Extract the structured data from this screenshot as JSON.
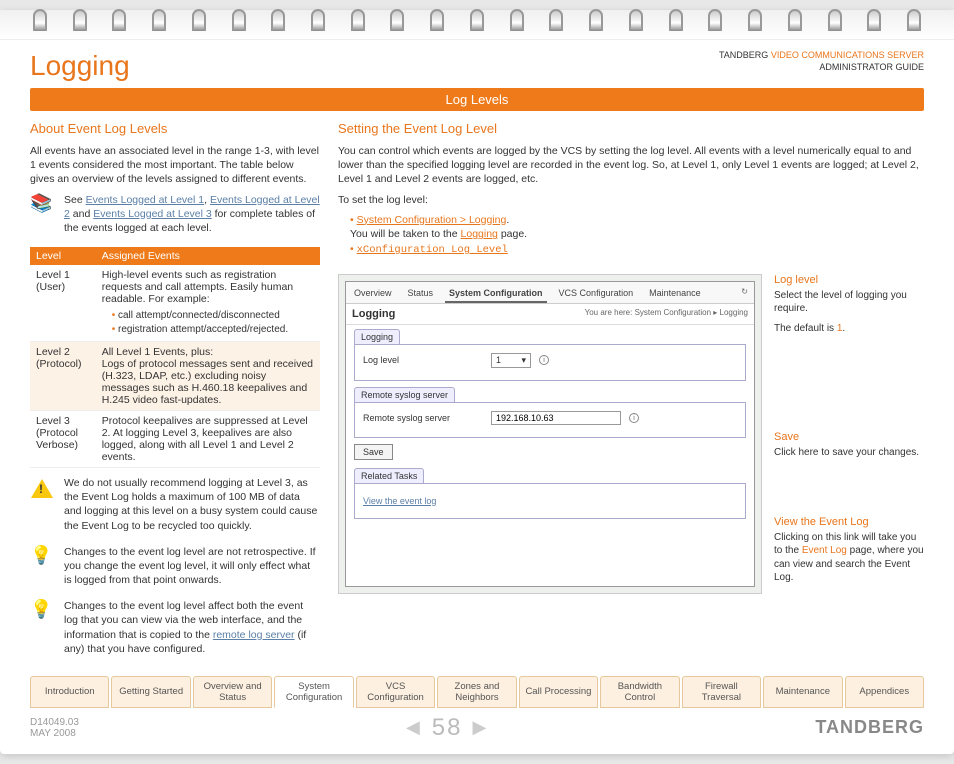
{
  "header": {
    "title": "Logging",
    "company": "TANDBERG",
    "product": "VIDEO COMMUNICATIONS SERVER",
    "guide": "ADMINISTRATOR GUIDE"
  },
  "bar": "Log Levels",
  "about": {
    "title": "About Event Log Levels",
    "intro": "All events have an associated level in the range 1-3, with level 1 events considered the most important. The table below gives an overview of the levels assigned to different events.",
    "see_pre": "See ",
    "link1": "Events Logged at Level 1",
    "link2": "Events Logged at Level 2",
    "and": " and ",
    "link3": "Events Logged at Level 3",
    "see_post": " for complete tables of the events logged at each level.",
    "th_level": "Level",
    "th_events": "Assigned Events",
    "rows": [
      {
        "level": "Level 1 (User)",
        "desc": "High-level events such as registration requests and call attempts. Easily human readable. For example:",
        "sub": [
          "call attempt/connected/disconnected",
          "registration attempt/accepted/rejected."
        ]
      },
      {
        "level": "Level 2 (Protocol)",
        "desc_pre": "All Level 1 Events, plus:",
        "desc": "Logs of protocol messages sent and received (H.323, LDAP, etc.) excluding noisy messages such as H.460.18 keepalives and H.245 video fast-updates."
      },
      {
        "level": "Level 3 (Protocol Verbose)",
        "desc": "Protocol keepalives are suppressed at Level 2. At logging Level 3, keepalives are also logged, along with all Level 1 and Level 2 events."
      }
    ],
    "warn": "We do not usually recommend logging at Level 3, as the Event Log holds a maximum of 100 MB of data and logging at this level on a busy system could cause the Event Log to be recycled too quickly.",
    "tip1": "Changes to the event log level are not retrospective.  If you change the event log level, it will only effect what is logged from that point onwards.",
    "tip2_pre": "Changes to the event log level affect both the event log that you can view via the web interface, and the information that is copied to the ",
    "tip2_link": "remote log server",
    "tip2_post": " (if any) that you have configured."
  },
  "setting": {
    "title": "Setting the Event Log Level",
    "intro": "You can control which events are logged by the VCS by setting the log level. All events with a level numerically equal to and lower than the specified logging level are recorded in the event log. So, at Level 1, only Level 1 events are logged; at Level 2, Level 1 and Level 2 events are logged, etc.",
    "toset": "To set the log level:",
    "nav": "System Configuration > Logging",
    "navpost": ".",
    "taken_pre": "You will be taken to the ",
    "taken_link": "Logging",
    "taken_post": " page.",
    "cmd": "xConfiguration Log Level"
  },
  "screenshot": {
    "tabs": [
      "Overview",
      "Status",
      "System Configuration",
      "VCS Configuration",
      "Maintenance"
    ],
    "active_tab": 2,
    "refresh": "↻",
    "heading": "Logging",
    "breadcrumb": "You are here: System Configuration ▸ Logging",
    "subtab": "Logging",
    "row1_label": "Log level",
    "row1_value": "1",
    "group2_label": "Remote syslog server",
    "row2_label": "Remote syslog server",
    "row2_value": "192.168.10.63",
    "save": "Save",
    "related": "Related Tasks",
    "viewlog": "View the event log"
  },
  "callouts": {
    "loglevel": {
      "title": "Log level",
      "body": "Select the level of logging you require.",
      "default_pre": "The default is ",
      "default_val": "1",
      "default_post": "."
    },
    "save": {
      "title": "Save",
      "body": "Click here to save your changes."
    },
    "view": {
      "title": "View the Event Log",
      "body_pre": "Clicking on this link will take you to the ",
      "body_link": "Event Log",
      "body_post": " page, where you can view and search the Event Log."
    }
  },
  "nav": [
    "Introduction",
    "Getting Started",
    "Overview and Status",
    "System Configuration",
    "VCS Configuration",
    "Zones and Neighbors",
    "Call Processing",
    "Bandwidth Control",
    "Firewall Traversal",
    "Maintenance",
    "Appendices"
  ],
  "nav_active": 3,
  "footer": {
    "docid": "D14049.03",
    "date": "MAY 2008",
    "page": "58",
    "brand": "TANDBERG"
  }
}
